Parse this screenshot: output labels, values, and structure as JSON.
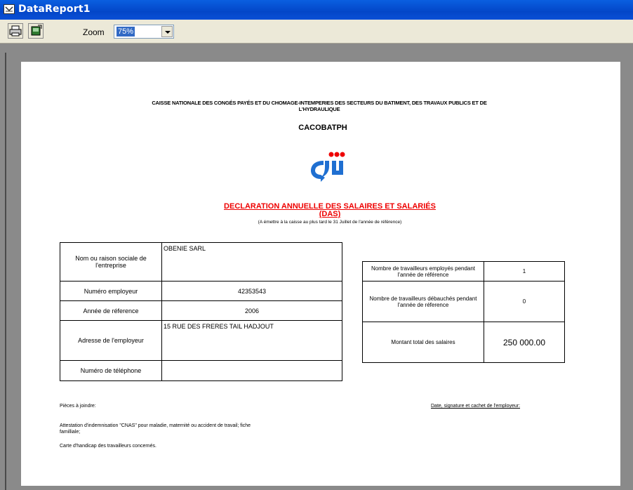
{
  "window": {
    "title": "DataReport1",
    "icon": "datareport-icon"
  },
  "toolbar": {
    "print_icon": "printer-icon",
    "export_icon": "export-icon",
    "zoom_label": "Zoom",
    "zoom_value": "75%"
  },
  "report": {
    "header_org": "CAISSE NATIONALE DES CONGÉS PAYÉS ET DU CHOMAGE-INTEMPERIES DES SECTEURS DU BATIMENT, DES TRAVAUX PUBLICS ET DE L'HYDRAULIQUE",
    "header_acronym": "CACOBATPH",
    "title": "DECLARATION ANNUELLE DES SALAIRES ET SALARIÉS",
    "title_abbr": "(DAS)",
    "note": "(A émettre à la caisse au plus tard le 31 Juillet de l'année de référence)",
    "left_table": {
      "company_label": "Nom ou raison sociale de l'entreprise",
      "company_value": "OBENIE SARL",
      "employer_no_label": "Numéro employeur",
      "employer_no_value": "42353543",
      "year_label": "Année de réference",
      "year_value": "2006",
      "address_label": "Adresse de l'employeur",
      "address_value": "15 RUE DES FRERES TAIL HADJOUT",
      "phone_label": "Numéro de téléphone",
      "phone_value": ""
    },
    "right_table": {
      "employed_label": "Nombre de travailleurs employés pendant l'année de référence",
      "employed_value": "1",
      "dismissed_label": "Nombre de travailleurs débauchés pendant l'année de réference",
      "dismissed_value": "0",
      "total_label": "Montant total des salaires",
      "total_value": "250 000.00"
    },
    "footer": {
      "pieces_label": "Pièces à joindre:",
      "signature_label": "Date, signature et cachet de l'employeur:",
      "item1": "Attestation d'indemnisation \"CNAS\" pour maladie, maternité ou accident de travail; fiche familliale;",
      "item2": "Carte d'handicap des travailleurs concernés."
    }
  }
}
